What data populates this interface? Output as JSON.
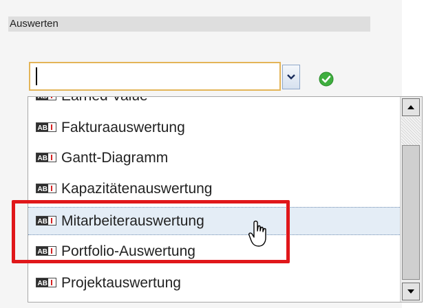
{
  "section": {
    "title": "Auswerten"
  },
  "combo": {
    "value": ""
  },
  "dropdown": {
    "items": [
      {
        "label": "Earned Value"
      },
      {
        "label": "Fakturaauswertung"
      },
      {
        "label": "Gantt-Diagramm"
      },
      {
        "label": "Kapazitätenauswertung"
      },
      {
        "label": "Mitarbeiterauswertung",
        "hovered": true
      },
      {
        "label": "Portfolio-Auswertung"
      },
      {
        "label": "Projektauswertung"
      }
    ]
  },
  "colors": {
    "highlight": "#e0171a",
    "combo_focus_border": "#e3b457",
    "hover_row": "#e4edf6",
    "check": "#3fae3f"
  },
  "icons": {
    "item": "text-field-icon",
    "confirm": "check-icon",
    "dropdown": "chevron-down-icon",
    "cursor": "hand-pointer-icon"
  }
}
